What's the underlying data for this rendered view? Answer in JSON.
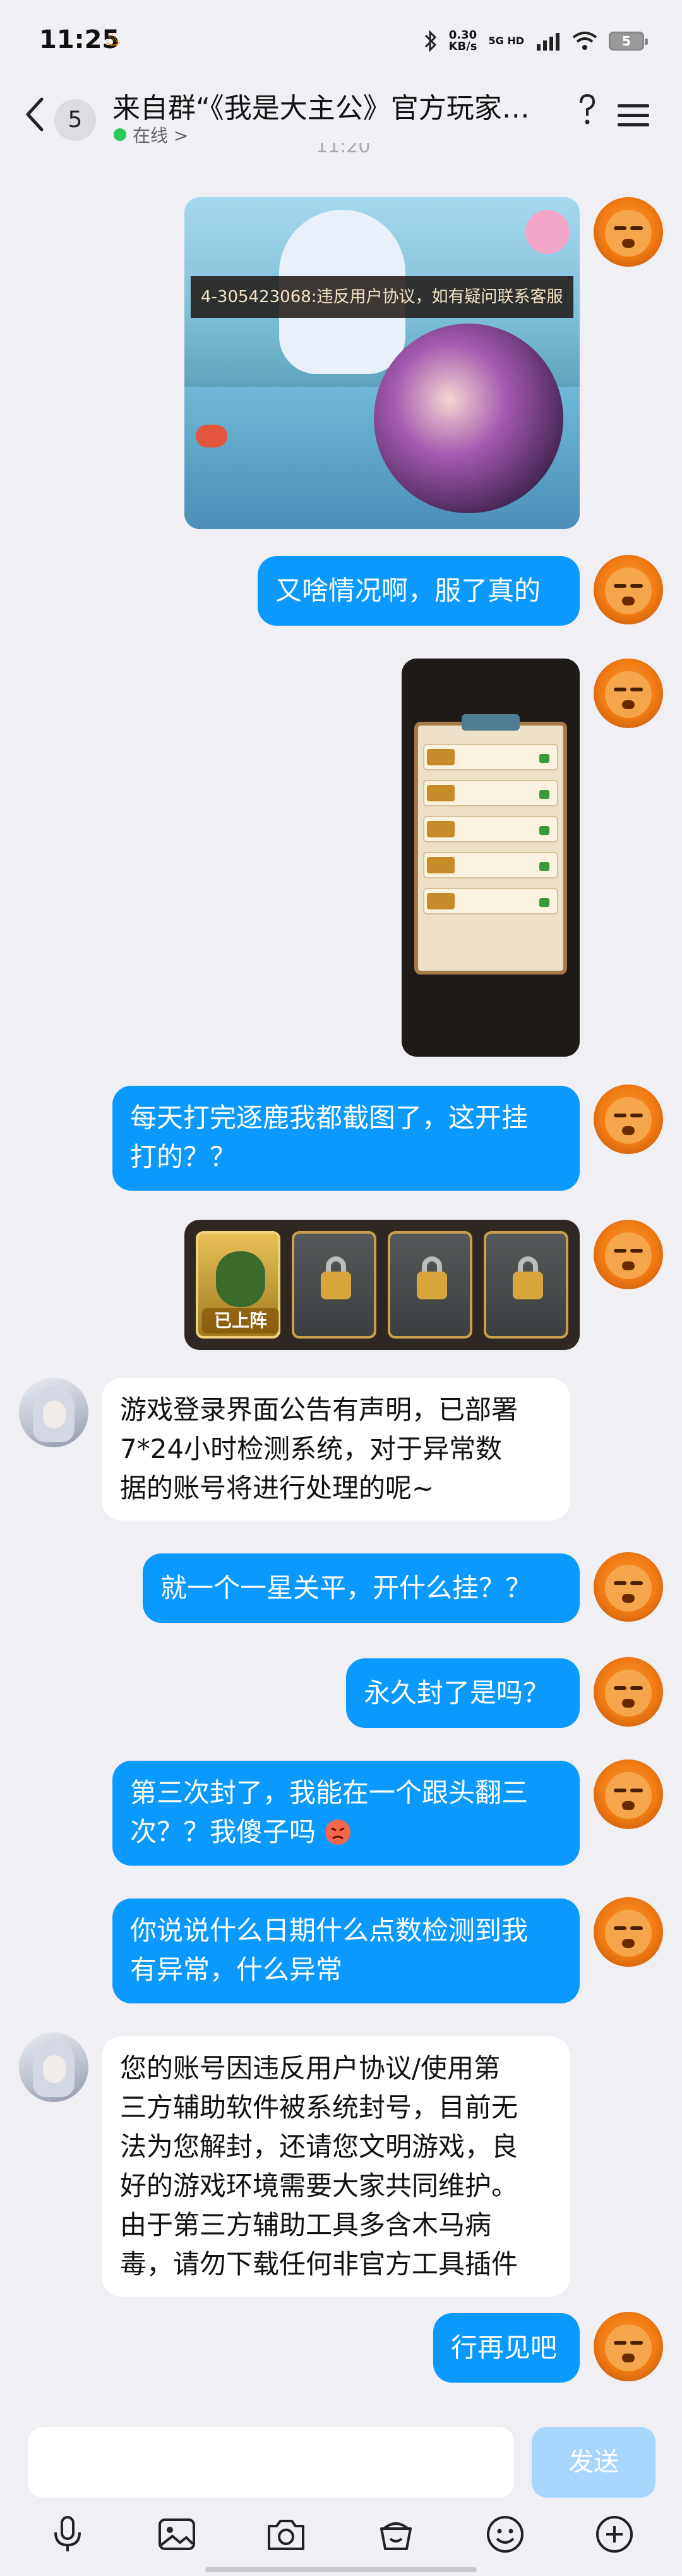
{
  "status_bar": {
    "time": "11:25",
    "net_speed": "0.30",
    "net_unit": "KB/s",
    "network": "5G HD",
    "battery": "5"
  },
  "header": {
    "unread_count": "5",
    "title": "来自群“《我是大主公》官方玩家…",
    "status": "在线 >"
  },
  "timestamp": "11:20",
  "messages": {
    "img1_banner": "4-305423068:违反用户协议，如有疑问联系客服",
    "m1": "又啥情况啊，服了真的",
    "m2_line1": "每天打完逐鹿我都截图了，这开挂",
    "m2_line2": "打的？？",
    "img3_label": "已上阵",
    "m3_line1": "游戏登录界面公告有声明，已部署",
    "m3_line2": "7*24小时检测系统，对于异常数",
    "m3_line3": "据的账号将进行处理的呢~",
    "m4": "就一个一星关平，开什么挂？？",
    "m5": "永久封了是吗？",
    "m6_line1": "第三次封了，我能在一个跟头翻三",
    "m6_line2": "次？？我傻子吗",
    "m7_line1": "你说说什么日期什么点数检测到我",
    "m7_line2": "有异常，什么异常",
    "m8_line1": "您的账号因违反用户协议/使用第",
    "m8_line2": "三方辅助软件被系统封号，目前无",
    "m8_line3": "法为您解封，还请您文明游戏，良",
    "m8_line4": "好的游戏环境需要大家共同维护。",
    "m8_line5": "由于第三方辅助工具多含木马病",
    "m8_line6": "毒，请勿下载任何非官方工具插件",
    "m9": "行再见吧"
  },
  "input": {
    "placeholder": "",
    "send_label": "发送"
  },
  "colors": {
    "self_bubble": "#0a99ff",
    "other_bubble": "#ffffff",
    "background": "#f0eff4",
    "send_disabled": "#a8d6ff"
  },
  "toolbar_icons": [
    "microphone-icon",
    "gallery-icon",
    "camera-icon",
    "red-packet-icon",
    "emoji-icon",
    "plus-icon"
  ]
}
